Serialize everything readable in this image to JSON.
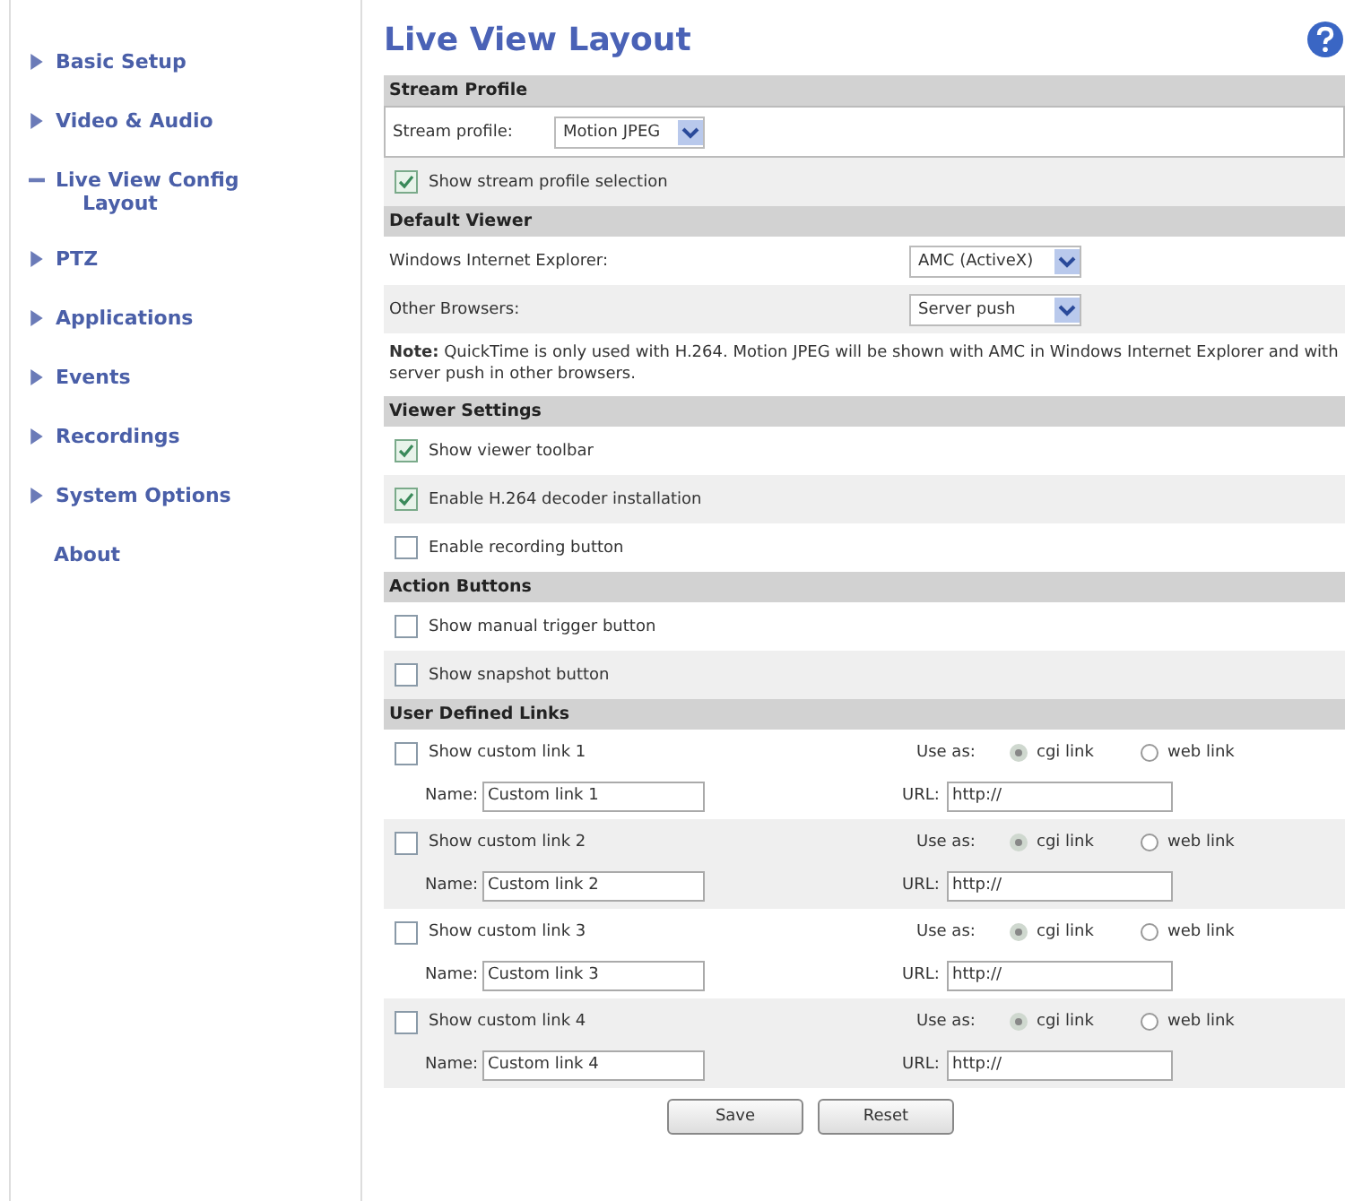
{
  "sidebar": {
    "items": [
      {
        "label": "Basic Setup",
        "kind": "menu",
        "expanded": false
      },
      {
        "label": "Video & Audio",
        "kind": "menu",
        "expanded": false
      },
      {
        "label": "Live View Config",
        "kind": "menu",
        "expanded": true,
        "children": [
          {
            "label": "Layout",
            "selected": true
          }
        ]
      },
      {
        "label": "PTZ",
        "kind": "menu",
        "expanded": false
      },
      {
        "label": "Applications",
        "kind": "menu",
        "expanded": false
      },
      {
        "label": "Events",
        "kind": "menu",
        "expanded": false
      },
      {
        "label": "Recordings",
        "kind": "menu",
        "expanded": false
      },
      {
        "label": "System Options",
        "kind": "menu",
        "expanded": false
      },
      {
        "label": "About",
        "kind": "link"
      }
    ]
  },
  "page": {
    "title": "Live View Layout",
    "sections": [
      {
        "heading": "Stream Profile",
        "rows": [
          {
            "kind": "select",
            "label": "Stream profile:",
            "value": "Motion JPEG"
          },
          {
            "kind": "checkbox",
            "label": "Show stream profile selection",
            "checked": true
          }
        ]
      },
      {
        "heading": "Default Viewer",
        "rows": [
          {
            "kind": "choice",
            "label": "Windows Internet Explorer:",
            "value": "AMC (ActiveX)"
          },
          {
            "kind": "choice",
            "label": "Other Browsers:",
            "value": "Server push"
          },
          {
            "kind": "note",
            "text": "**Note:** QuickTime is only used with H.264. Motion JPEG will be shown with AMC in Windows Internet Explorer and with server push in other browsers."
          }
        ]
      },
      {
        "heading": "Viewer Settings",
        "rows": [
          {
            "kind": "checkbox",
            "label": "Show viewer toolbar",
            "checked": true
          },
          {
            "kind": "checkbox",
            "label": "Enable H.264 decoder installation",
            "checked": true
          },
          {
            "kind": "checkbox",
            "label": "Enable recording button",
            "checked": false
          }
        ]
      },
      {
        "heading": "Action Buttons",
        "rows": [
          {
            "kind": "checkbox",
            "label": "Show manual trigger button",
            "checked": false
          },
          {
            "kind": "checkbox",
            "label": "Show snapshot button",
            "checked": false
          }
        ]
      },
      {
        "heading": "User Defined Links",
        "rows": [
          {
            "kind": "link",
            "label": "Show custom link 1",
            "checked": false,
            "use_as": "Use as:",
            "options": [
              {
                "label": "cgi link",
                "selected": true
              },
              {
                "label": "web link",
                "selected": false
              }
            ],
            "name_label": "Name:",
            "name_value": "Custom link 1",
            "url_label": "URL:",
            "url_value": "http://"
          },
          {
            "kind": "link",
            "label": "Show custom link 2",
            "checked": false,
            "use_as": "Use as:",
            "options": [
              {
                "label": "cgi link",
                "selected": true
              },
              {
                "label": "web link",
                "selected": false
              }
            ],
            "name_label": "Name:",
            "name_value": "Custom link 2",
            "url_label": "URL:",
            "url_value": "http://"
          },
          {
            "kind": "link",
            "label": "Show custom link 3",
            "checked": false,
            "use_as": "Use as:",
            "options": [
              {
                "label": "cgi link",
                "selected": true
              },
              {
                "label": "web link",
                "selected": false
              }
            ],
            "name_label": "Name:",
            "name_value": "Custom link 3",
            "url_label": "URL:",
            "url_value": "http://"
          },
          {
            "kind": "link",
            "label": "Show custom link 4",
            "checked": false,
            "use_as": "Use as:",
            "options": [
              {
                "label": "cgi link",
                "selected": true
              },
              {
                "label": "web link",
                "selected": false
              }
            ],
            "name_label": "Name:",
            "name_value": "Custom link 4",
            "url_label": "URL:",
            "url_value": "http://"
          }
        ]
      }
    ],
    "buttons": [
      "Save",
      "Reset"
    ]
  }
}
